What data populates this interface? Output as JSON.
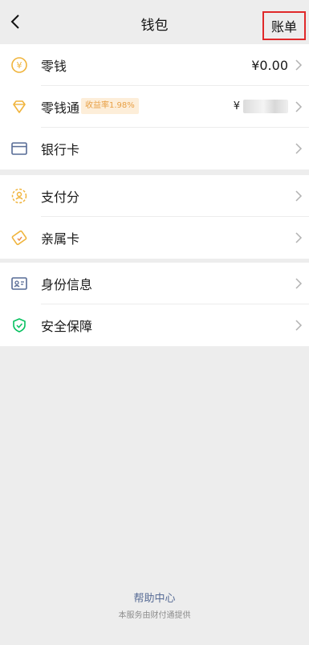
{
  "header": {
    "title": "钱包",
    "bill_label": "账单"
  },
  "group1": [
    {
      "label": "零钱",
      "value": "¥0.00"
    },
    {
      "label": "零钱通",
      "badge": "收益率1.98%",
      "value_prefix": "¥"
    },
    {
      "label": "银行卡"
    }
  ],
  "group2": [
    {
      "label": "支付分"
    },
    {
      "label": "亲属卡"
    }
  ],
  "group3": [
    {
      "label": "身份信息"
    },
    {
      "label": "安全保障"
    }
  ],
  "footer": {
    "help": "帮助中心",
    "note": "本服务由财付通提供"
  },
  "colors": {
    "accent_gold": "#f0b43c",
    "accent_blue": "#576b95",
    "accent_green": "#07c160",
    "highlight_red": "#e0292a"
  }
}
